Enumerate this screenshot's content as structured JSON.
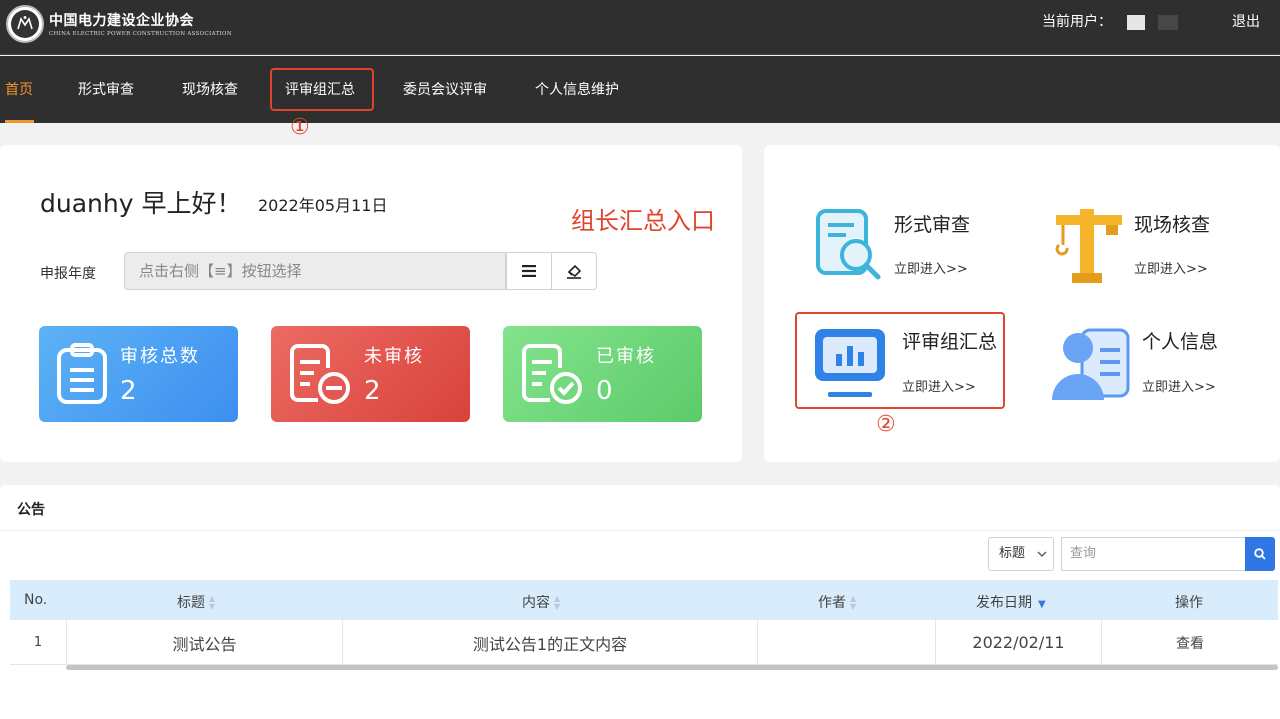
{
  "header": {
    "logo_cn": "中国电力建设企业协会",
    "logo_en": "CHINA ELECTRIC POWER CONSTRUCTION ASSOCIATION",
    "user_label": "当前用户：",
    "logout": "退出"
  },
  "nav": {
    "items": [
      "首页",
      "形式审查",
      "现场核查",
      "评审组汇总",
      "委员会议评审",
      "个人信息维护"
    ],
    "active_index": 0,
    "annotation_num": "①"
  },
  "welcome": {
    "greeting": "duanhy 早上好！",
    "date": "2022年05月11日",
    "annotation": "组长汇总入口",
    "year_label": "申报年度",
    "year_placeholder": "点击右侧【≡】按钮选择"
  },
  "stats": [
    {
      "title": "审核总数",
      "value": "2",
      "color": "#4aa3f3"
    },
    {
      "title": "未审核",
      "value": "2",
      "color": "#e2514a"
    },
    {
      "title": "已审核",
      "value": "0",
      "color": "#6dd97a"
    }
  ],
  "quick_links": {
    "link_text": "立即进入>>",
    "items": [
      "形式审查",
      "现场核查",
      "评审组汇总",
      "个人信息"
    ],
    "annotation_num": "②"
  },
  "notice": {
    "title": "公告",
    "filter_option": "标题",
    "search_placeholder": "查询",
    "columns": [
      "No.",
      "标题",
      "内容",
      "作者",
      "发布日期",
      "操作"
    ],
    "rows": [
      {
        "no": "1",
        "title": "测试公告",
        "content": "测试公告1的正文内容",
        "author": "",
        "date": "2022/02/11",
        "action": "查看"
      }
    ]
  },
  "colors": {
    "accent": "#f0962b",
    "annotation": "#e0452c",
    "header_bg": "#2f2f2f",
    "primary": "#2f77e4"
  }
}
